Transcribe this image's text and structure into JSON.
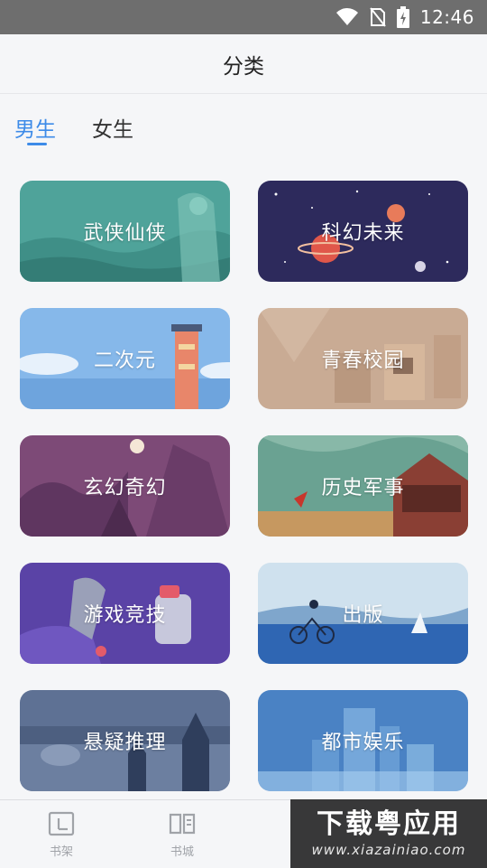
{
  "status_bar": {
    "time": "12:46"
  },
  "header": {
    "title": "分类"
  },
  "tabs": [
    {
      "label": "男生",
      "active": true
    },
    {
      "label": "女生",
      "active": false
    }
  ],
  "categories": [
    {
      "label": "武侠仙侠",
      "theme": "teal"
    },
    {
      "label": "科幻未来",
      "theme": "space"
    },
    {
      "label": "二次元",
      "theme": "sky"
    },
    {
      "label": "青春校园",
      "theme": "beige"
    },
    {
      "label": "玄幻奇幻",
      "theme": "purple"
    },
    {
      "label": "历史军事",
      "theme": "green"
    },
    {
      "label": "游戏竞技",
      "theme": "violet"
    },
    {
      "label": "出版",
      "theme": "ocean"
    },
    {
      "label": "悬疑推理",
      "theme": "slate"
    },
    {
      "label": "都市娱乐",
      "theme": "city"
    }
  ],
  "bottom_nav": [
    {
      "label": "书架",
      "icon": "bookshelf-icon"
    },
    {
      "label": "书城",
      "icon": "book-open-icon"
    }
  ],
  "watermark": {
    "main": "下载粤应用",
    "sub": "www.xiazainiao.com"
  },
  "colors": {
    "accent": "#3d8be8",
    "status_bar": "#6e6e6e",
    "background": "#f5f6f8"
  }
}
